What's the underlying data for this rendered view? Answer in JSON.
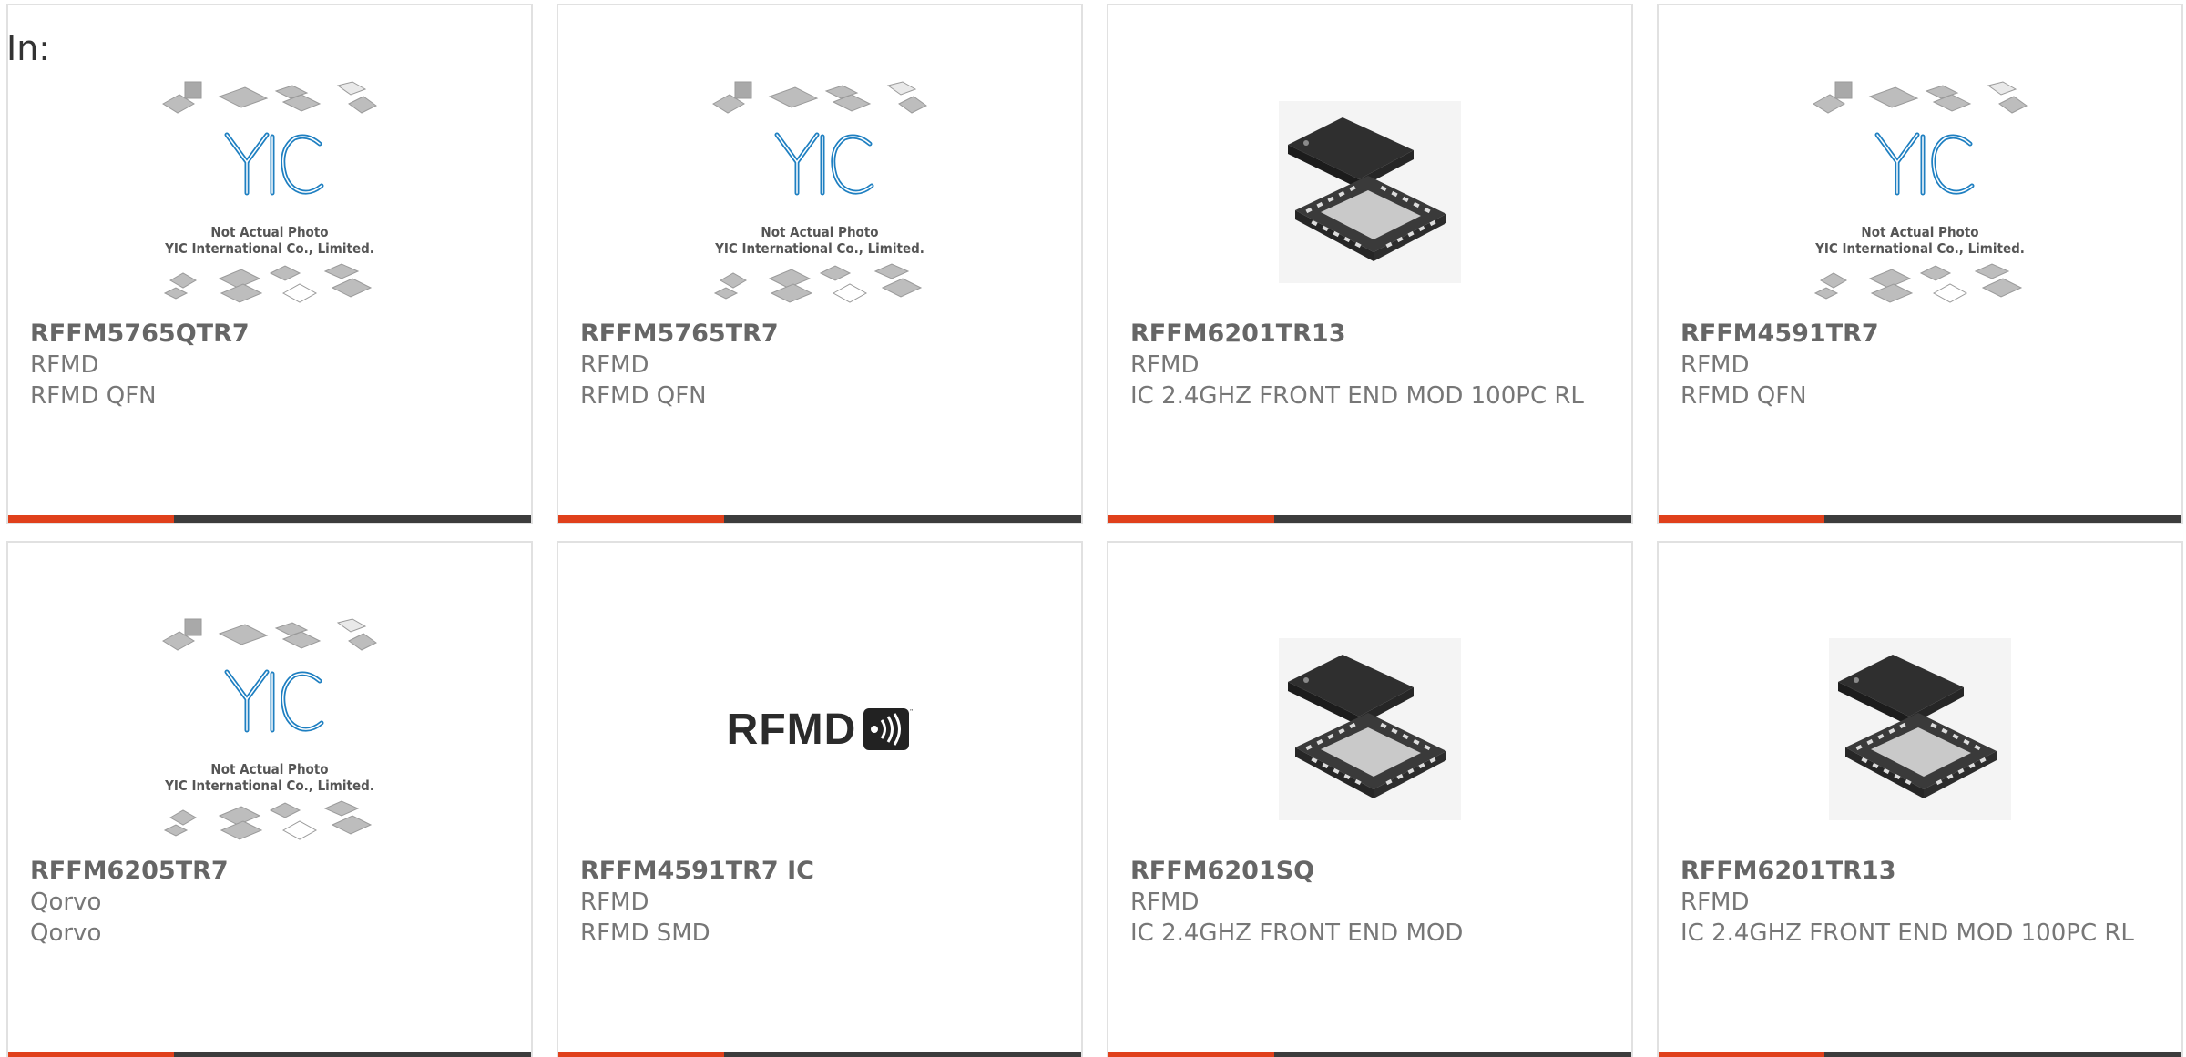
{
  "heading": "In:",
  "placeholder": {
    "line1": "Not Actual Photo",
    "line2": "YIC International Co., Limited."
  },
  "colors": {
    "accent": "#e0401b",
    "bar": "#3c3c3c",
    "border": "#e1e1e1",
    "text": "#666666"
  },
  "products": [
    {
      "part": "RFFM5765QTR7",
      "mfr": "RFMD",
      "desc": "RFMD QFN",
      "image": "placeholder"
    },
    {
      "part": "RFFM5765TR7",
      "mfr": "RFMD",
      "desc": "RFMD QFN",
      "image": "placeholder"
    },
    {
      "part": "RFFM6201TR13",
      "mfr": "RFMD",
      "desc": "IC 2.4GHZ FRONT END MOD 100PC RL",
      "image": "qfn-chip"
    },
    {
      "part": "RFFM4591TR7",
      "mfr": "RFMD",
      "desc": "RFMD QFN",
      "image": "placeholder"
    },
    {
      "part": "RFFM6205TR7",
      "mfr": "Qorvo",
      "desc": "Qorvo",
      "image": "placeholder"
    },
    {
      "part": "RFFM4591TR7 IC",
      "mfr": "RFMD",
      "desc": "RFMD SMD",
      "image": "rfmd-logo"
    },
    {
      "part": "RFFM6201SQ",
      "mfr": "RFMD",
      "desc": "IC 2.4GHZ FRONT END MOD",
      "image": "qfn-chip"
    },
    {
      "part": "RFFM6201TR13",
      "mfr": "RFMD",
      "desc": "IC 2.4GHZ FRONT END MOD 100PC RL",
      "image": "qfn-chip"
    }
  ],
  "rfmd_logo_text": "RFMD"
}
